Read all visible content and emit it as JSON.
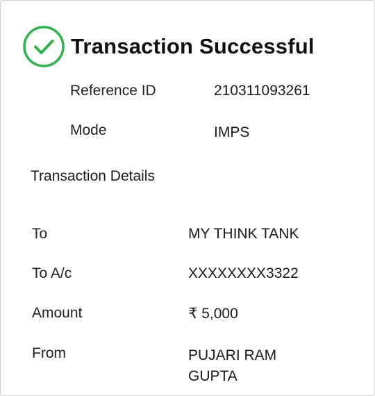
{
  "header": {
    "title": "Transaction Successful",
    "status_icon": "check-circle-icon",
    "accent_color": "#2fb24a"
  },
  "summary": {
    "reference_label": "Reference ID",
    "reference_value": "210311093261",
    "mode_label": "Mode",
    "mode_value": "IMPS"
  },
  "details": {
    "section_title": "Transaction Details",
    "to_label": "To",
    "to_value": "MY THINK TANK",
    "account_label": "To A/c",
    "account_value": "XXXXXXXX3322",
    "amount_label": "Amount",
    "amount_value": "₹ 5,000",
    "from_label": "From",
    "from_value_line1": "PUJARI RAM",
    "from_value_line2": "GUPTA"
  }
}
